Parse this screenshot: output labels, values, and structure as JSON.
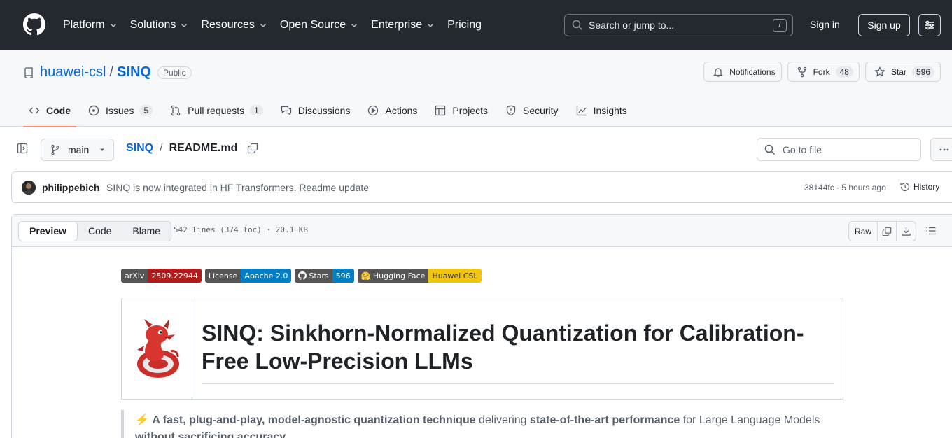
{
  "header": {
    "nav": [
      {
        "label": "Platform",
        "dropdown": true
      },
      {
        "label": "Solutions",
        "dropdown": true
      },
      {
        "label": "Resources",
        "dropdown": true
      },
      {
        "label": "Open Source",
        "dropdown": true
      },
      {
        "label": "Enterprise",
        "dropdown": true
      },
      {
        "label": "Pricing",
        "dropdown": false
      }
    ],
    "search_placeholder": "Search or jump to...",
    "search_shortcut": "/",
    "sign_in": "Sign in",
    "sign_up": "Sign up"
  },
  "repo": {
    "owner": "huawei-csl",
    "separator": "/",
    "name": "SINQ",
    "visibility": "Public",
    "notifications_label": "Notifications",
    "fork_label": "Fork",
    "fork_count": "48",
    "star_label": "Star",
    "star_count": "596",
    "tabs": [
      {
        "label": "Code",
        "count": null,
        "icon": "code-icon",
        "active": true
      },
      {
        "label": "Issues",
        "count": "5",
        "icon": "issue-icon",
        "active": false
      },
      {
        "label": "Pull requests",
        "count": "1",
        "icon": "pull-request-icon",
        "active": false
      },
      {
        "label": "Discussions",
        "count": null,
        "icon": "discussions-icon",
        "active": false
      },
      {
        "label": "Actions",
        "count": null,
        "icon": "actions-icon",
        "active": false
      },
      {
        "label": "Projects",
        "count": null,
        "icon": "projects-icon",
        "active": false
      },
      {
        "label": "Security",
        "count": null,
        "icon": "shield-icon",
        "active": false
      },
      {
        "label": "Insights",
        "count": null,
        "icon": "graph-icon",
        "active": false
      }
    ]
  },
  "filebar": {
    "branch": "main",
    "crumb_repo": "SINQ",
    "crumb_sep": "/",
    "crumb_file": "README.md",
    "goto_placeholder": "Go to file"
  },
  "commit": {
    "author": "philippebich",
    "message": "SINQ is now integrated in HF Transformers. Readme update",
    "meta": "38144fc · 5 hours ago",
    "history_label": "History"
  },
  "fileview": {
    "tabs": [
      "Preview",
      "Code",
      "Blame"
    ],
    "stats": "542 lines (374 loc) · 20.1 KB",
    "raw_label": "Raw"
  },
  "readme": {
    "badges": [
      {
        "left": "arXiv",
        "right": "2509.22944",
        "color": "#b31b1b",
        "icon": null
      },
      {
        "left": "License",
        "right": "Apache 2.0",
        "color": "#007ec6",
        "icon": null
      },
      {
        "left": "Stars",
        "right": "596",
        "color": "#007ec6",
        "icon": "github-icon"
      },
      {
        "left": "🤗 Hugging Face",
        "right": "Huawei CSL",
        "color": "#f1c40f",
        "icon": null
      }
    ],
    "title": "SINQ: Sinkhorn-Normalized Quantization for Calibration-Free Low-Precision LLMs",
    "quote": {
      "icon": "⚡",
      "bold1": "A fast, plug-and-play, model-agnostic quantization technique",
      "text1": " delivering ",
      "bold2": "state-of-the-art performance",
      "text2": " for Large Language Models ",
      "bold3": "without sacrificing accuracy",
      "text3": "."
    }
  },
  "colors": {
    "header_bg": "#24292f",
    "link": "#0969da",
    "active_tab_underline": "#fd8c73"
  }
}
